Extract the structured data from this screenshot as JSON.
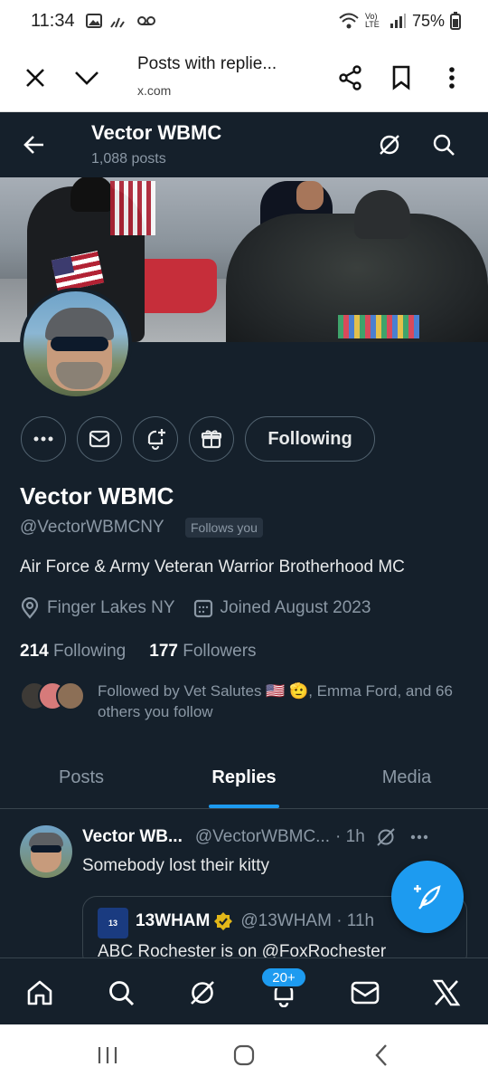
{
  "status_bar": {
    "time": "11:34",
    "battery": "75%",
    "network": "Vo) LTE"
  },
  "custom_tab": {
    "title": "Posts with replie...",
    "url": "x.com"
  },
  "header": {
    "name": "Vector WBMC",
    "posts_count": "1,088 posts"
  },
  "profile": {
    "display_name": "Vector WBMC",
    "handle": "@VectorWBMCNY",
    "follows_you": "Follows you",
    "bio": "Air Force & Army Veteran Warrior Brotherhood MC",
    "location": "Finger Lakes NY",
    "joined": "Joined August 2023",
    "following_count": "214",
    "following_label": "Following",
    "followers_count": "177",
    "followers_label": "Followers",
    "followed_by": "Followed by Vet Salutes 🇺🇸 🫡, Emma Ford, and 66 others you follow",
    "follow_button": "Following"
  },
  "tabs": [
    {
      "label": "Posts",
      "active": false
    },
    {
      "label": "Replies",
      "active": true
    },
    {
      "label": "Media",
      "active": false
    }
  ],
  "tweet": {
    "name": "Vector WB...",
    "handle": "@VectorWBMC...",
    "time": "· 1h",
    "text": "Somebody lost their kitty",
    "quote": {
      "name": "13WHAM",
      "handle": "@13WHAM · 11h",
      "text": "ABC Rochester is on @FoxRochester"
    }
  },
  "bottom_nav": {
    "notifications_badge": "20+"
  },
  "colors": {
    "background": "#15202b",
    "accent": "#1d9bf0",
    "muted": "#8b98a5",
    "border": "#38444d"
  }
}
